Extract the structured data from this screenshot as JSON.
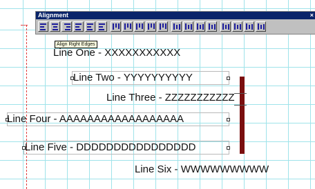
{
  "palette": {
    "title": "Alignment",
    "close_glyph": "×",
    "tools": [
      "align-left-edges-icon",
      "align-centers-icon",
      "align-right-edges-icon",
      "align-left-text-icon",
      "align-justify-icon",
      "align-spread-icon",
      "align-top-edges-icon",
      "align-middles-icon",
      "align-bottom-edges-icon",
      "align-baselines-icon",
      "align-vertical-spread-icon",
      "distribute-left-icon",
      "distribute-center-icon",
      "distribute-right-icon",
      "distribute-horizontal-icon",
      "distribute-top-icon",
      "distribute-middle-icon",
      "distribute-bottom-icon",
      "distribute-vertical-icon"
    ]
  },
  "tooltip": "Align Right Edges",
  "lines": {
    "one": "Line One - XXXXXXXXXXX",
    "two": "Line Two - YYYYYYYYYY",
    "three": "Line Three - ZZZZZZZZZZZ",
    "four": "Line Four - AAAAAAAAAAAAAAAAAA",
    "five": "Line Five - DDDDDDDDDDDDDDDD",
    "six": "Line Six - WWWWWWWWW"
  },
  "colors": {
    "grid": "#9fe3ea",
    "bar": "#7a0f0f",
    "guide": "#e23a3a",
    "palette_title": "#0a246a"
  }
}
